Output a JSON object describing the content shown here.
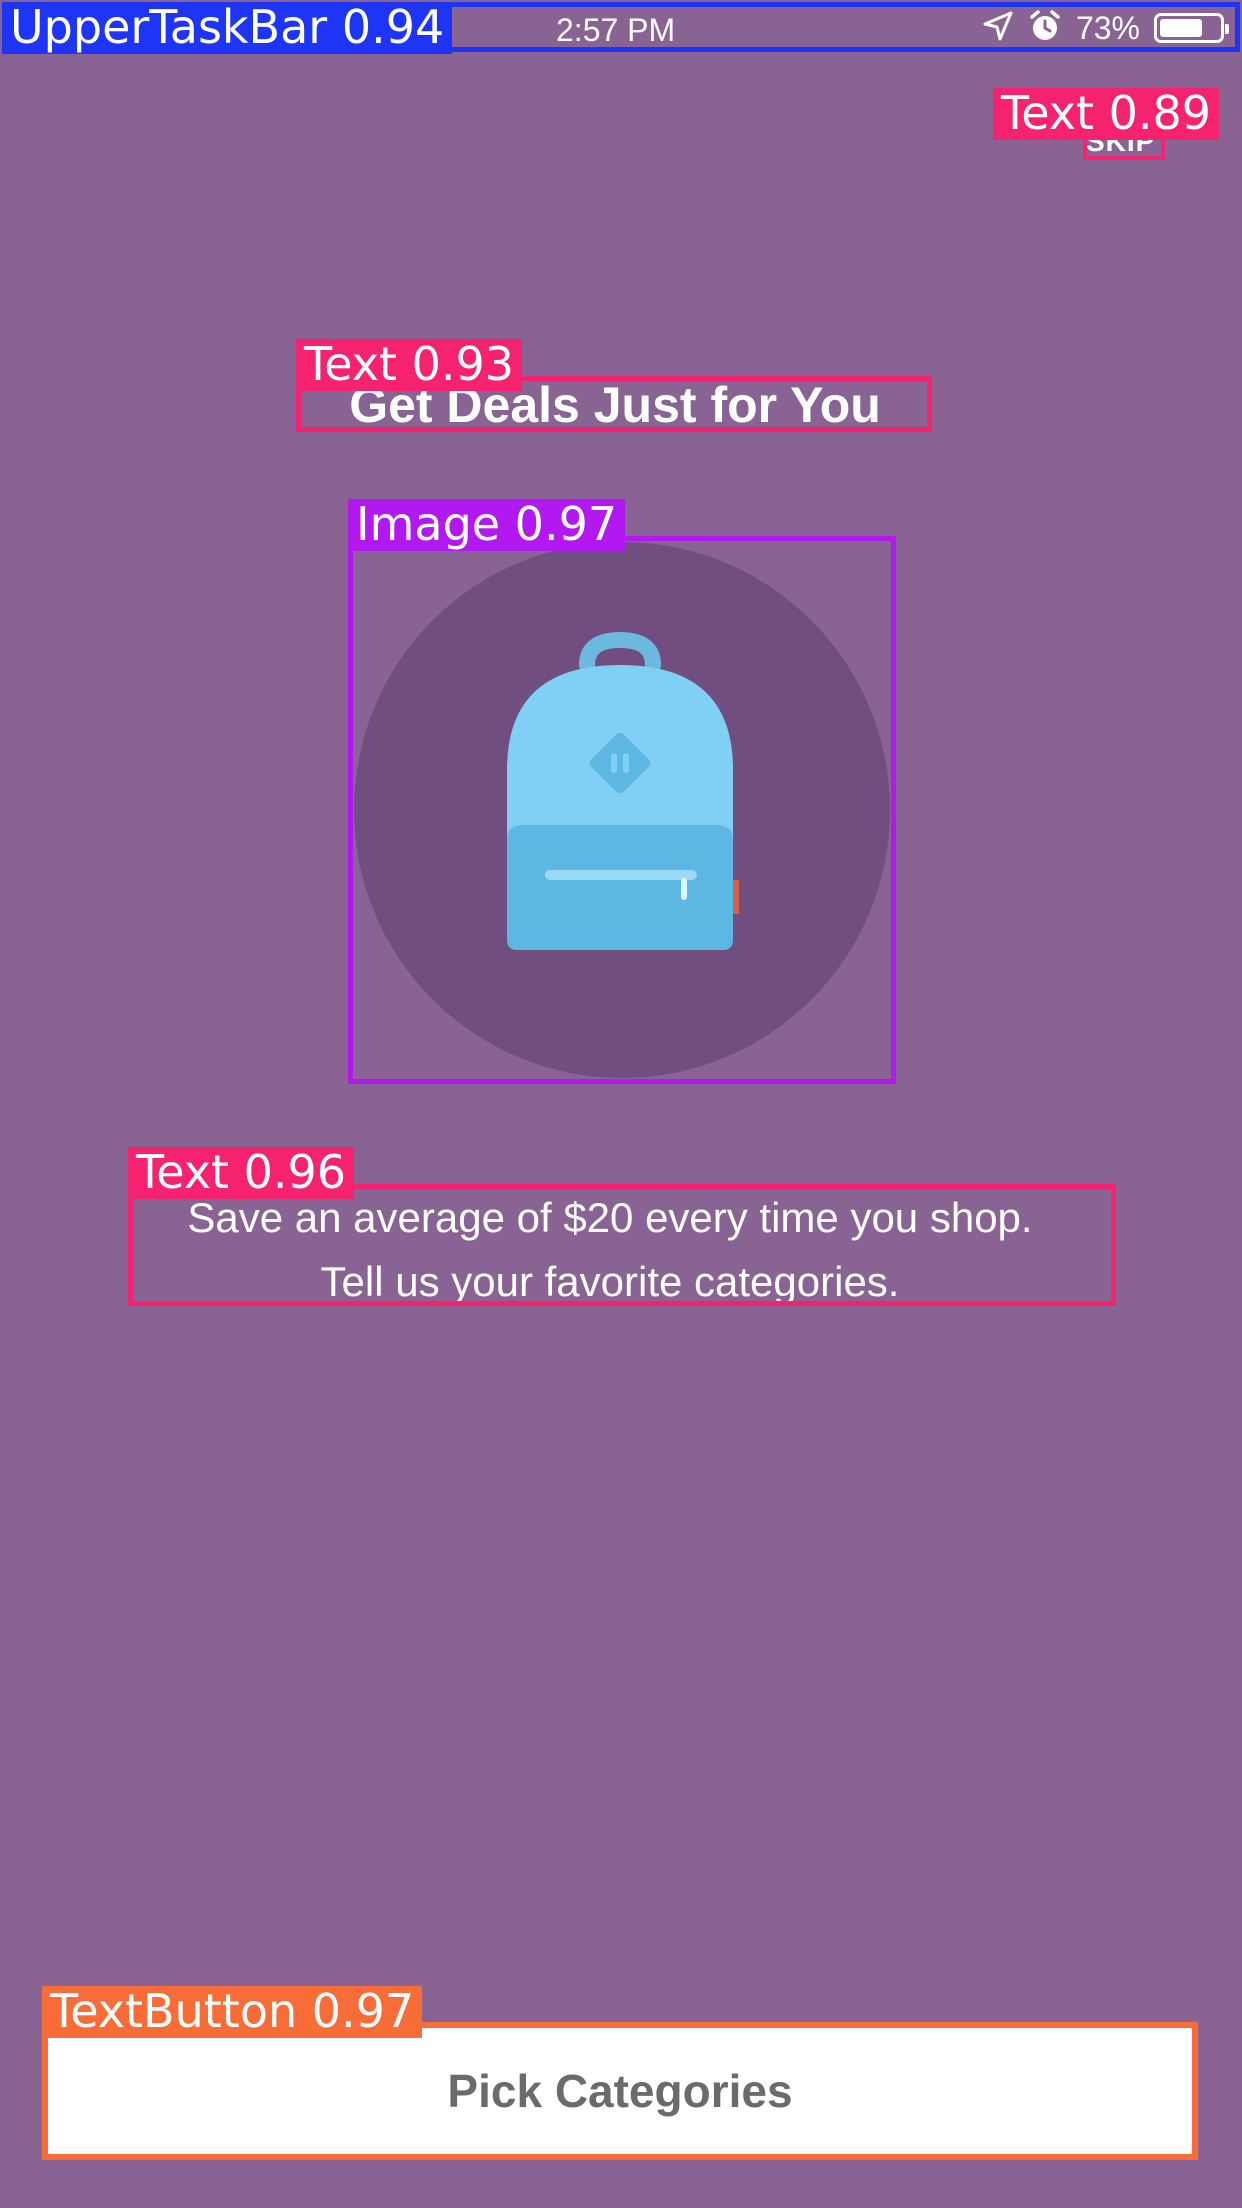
{
  "status_bar": {
    "time": "2:57 PM",
    "battery_percent": "73%",
    "battery_level": 0.73,
    "icons": [
      "location-arrow-icon",
      "alarm-icon",
      "battery-icon"
    ]
  },
  "onboarding": {
    "skip_label": "SKIP",
    "title": "Get Deals Just for You",
    "illustration_icon": "backpack-icon",
    "subtitle_line1": "Save an average of $20 every time you shop.",
    "subtitle_line2": "Tell us your favorite categories.",
    "button_label": "Pick Categories"
  },
  "colors": {
    "background": "#896394",
    "circle": "#714e80",
    "backpack_light": "#80cff4",
    "backpack_dark": "#5cb7e2",
    "button_text": "#6b6b6b"
  },
  "detections": [
    {
      "label": "UpperTaskBar 0.94",
      "color": "#1f35f5"
    },
    {
      "label": "Text 0.89",
      "color": "#f5236f"
    },
    {
      "label": "Text 0.93",
      "color": "#f5236f"
    },
    {
      "label": "Image 0.97",
      "color": "#b219f0"
    },
    {
      "label": "Text 0.96",
      "color": "#f5236f"
    },
    {
      "label": "TextButton 0.97",
      "color": "#f86c38"
    }
  ]
}
